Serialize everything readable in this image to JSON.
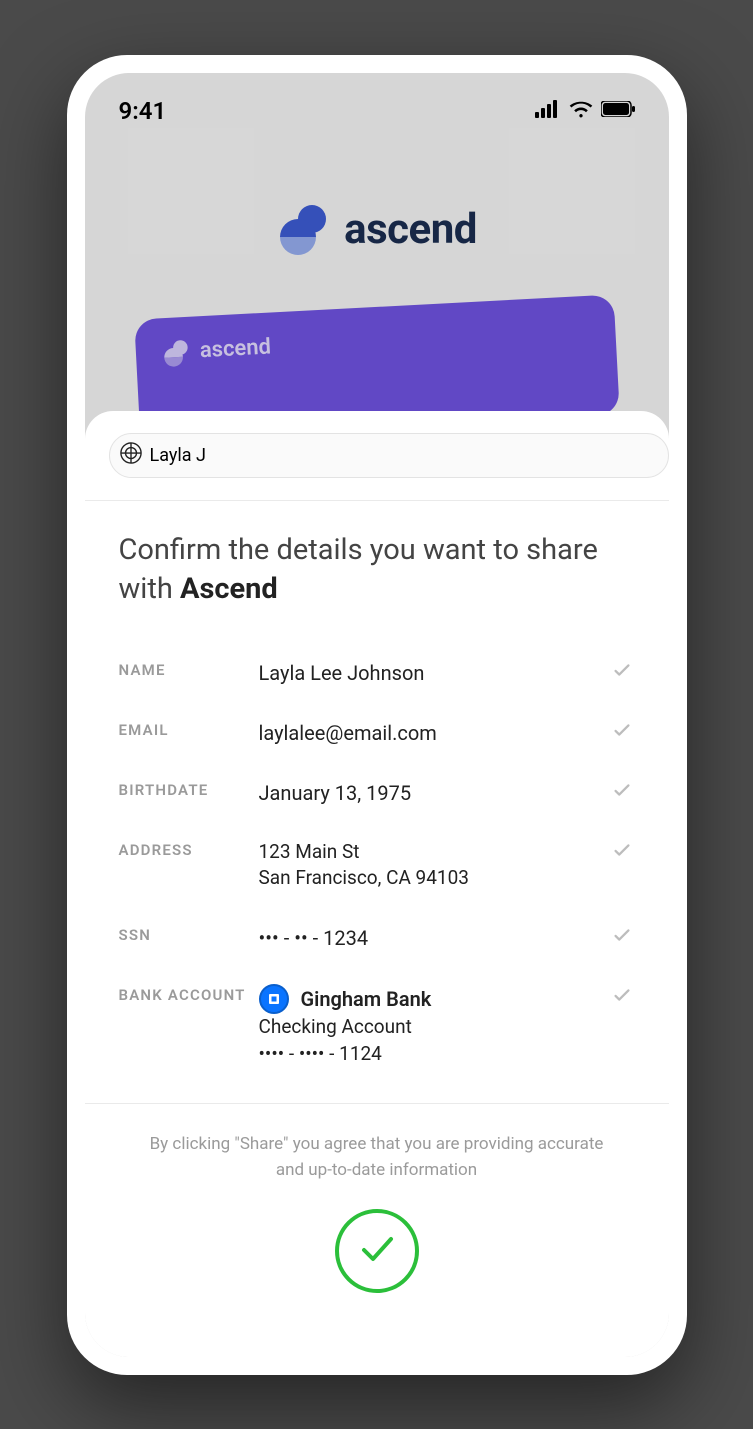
{
  "status": {
    "time": "9:41"
  },
  "brand": {
    "name": "ascend",
    "card_name": "ascend"
  },
  "sheet": {
    "user_chip": "Layla J",
    "title_prefix": "Confirm the details you want to share with ",
    "title_target": "Ascend",
    "details": {
      "name": {
        "label": "NAME",
        "value": "Layla Lee Johnson"
      },
      "email": {
        "label": "EMAIL",
        "value": "laylalee@email.com"
      },
      "birthdate": {
        "label": "BIRTHDATE",
        "value": "January 13, 1975"
      },
      "address": {
        "label": "ADDRESS",
        "line1": "123 Main St",
        "line2": "San Francisco, CA 94103"
      },
      "ssn": {
        "label": "SSN",
        "value": "••• - •• - 1234"
      },
      "bank": {
        "label": "BANK ACCOUNT",
        "name": "Gingham Bank",
        "type": "Checking Account",
        "number": "•••• - •••• - 1124"
      }
    },
    "footer": "By clicking \"Share\" you agree that you are providing accurate and up-to-date information"
  }
}
